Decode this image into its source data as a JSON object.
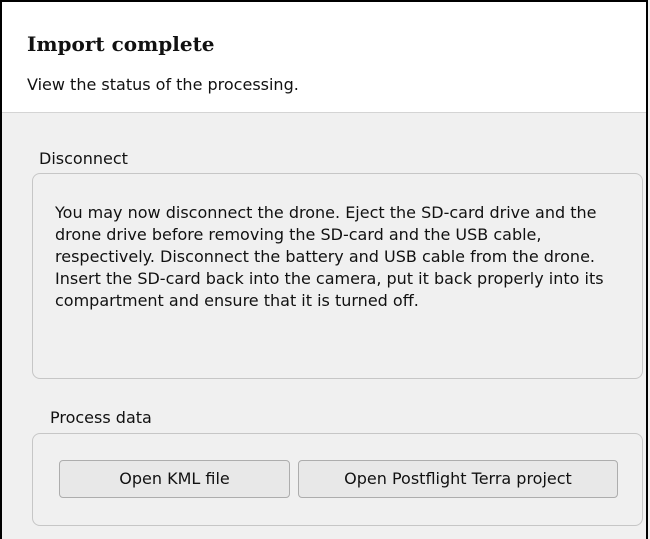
{
  "header": {
    "title": "Import complete",
    "subtitle": "View the status of the processing."
  },
  "disconnect": {
    "title": "Disconnect",
    "message": "You may now disconnect the drone. Eject the SD-card drive and the drone drive before removing the SD-card and the USB cable, respectively. Disconnect the battery and USB cable from the drone. Insert the SD-card back into the camera, put it back properly into its compartment and ensure that it is turned off."
  },
  "process": {
    "title": "Process data",
    "buttons": {
      "open_kml": "Open KML file",
      "open_terra": "Open Postflight Terra project"
    }
  }
}
